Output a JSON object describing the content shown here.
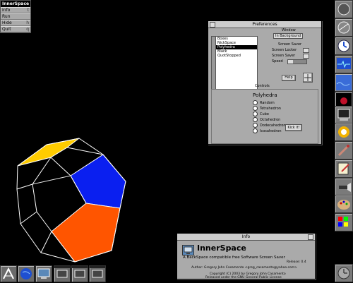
{
  "app_menu": {
    "title": "InnerSpace",
    "items": [
      {
        "label": "Info",
        "key": "t"
      },
      {
        "label": "Run",
        "key": ""
      },
      {
        "label": "Hide",
        "key": "h"
      },
      {
        "label": "Quit",
        "key": "q"
      }
    ]
  },
  "preferences": {
    "title": "Preferences",
    "modules": [
      "Boxes",
      "NickSpace",
      "Polyhedra",
      "Black",
      "QuotStopped"
    ],
    "selected_module": "Polyhedra",
    "window_label": "Window",
    "window_select": "In Background",
    "screen_saver_label": "Screen Saver",
    "screen_locker": "Screen Locker",
    "screen_saver": "Screen Saver",
    "speed": "Speed",
    "speed_level": 0.25,
    "help_button": "Help",
    "controls_label": "Controls",
    "controls_title": "Polyhedra",
    "options": [
      "Random",
      "Tetrahedron",
      "Cube",
      "Octahedron",
      "Dodecahedron",
      "Icosahedron"
    ],
    "kick_button": "Kick it!"
  },
  "info": {
    "title": "Info",
    "app_name": "InnerSpace",
    "tagline": "A BackSpace compatible free Software Screen Saver",
    "release": "Release: 0.4",
    "author": "Author: Gregory John Casamento <greg_casamento@yahoo.com>",
    "copyright": "Copyright (C) 2003 by Gregory John Casamento",
    "license": "Released under the GNU General Public License"
  },
  "colors": {
    "face_yellow": "#ffcc00",
    "face_blue": "#0a1ff0",
    "face_orange": "#ff5500",
    "dock_blue": "#1f4fd0"
  },
  "dock_icons": [
    "power-icon",
    "globe-icon",
    "clock-icon",
    "screen-blue-icon",
    "wave-icon",
    "red-screen-icon",
    "terminal-icon",
    "paint-icon",
    "brush-icon",
    "text-editor-icon",
    "flashlight-icon",
    "palette-icon",
    "colors-icon",
    "clock2-icon"
  ],
  "bottom_icons": [
    "wmaker-icon",
    "globe-icon",
    "monitor-icon",
    "mini-window-1",
    "mini-window-2",
    "mini-window-3",
    "mini-window-4"
  ]
}
